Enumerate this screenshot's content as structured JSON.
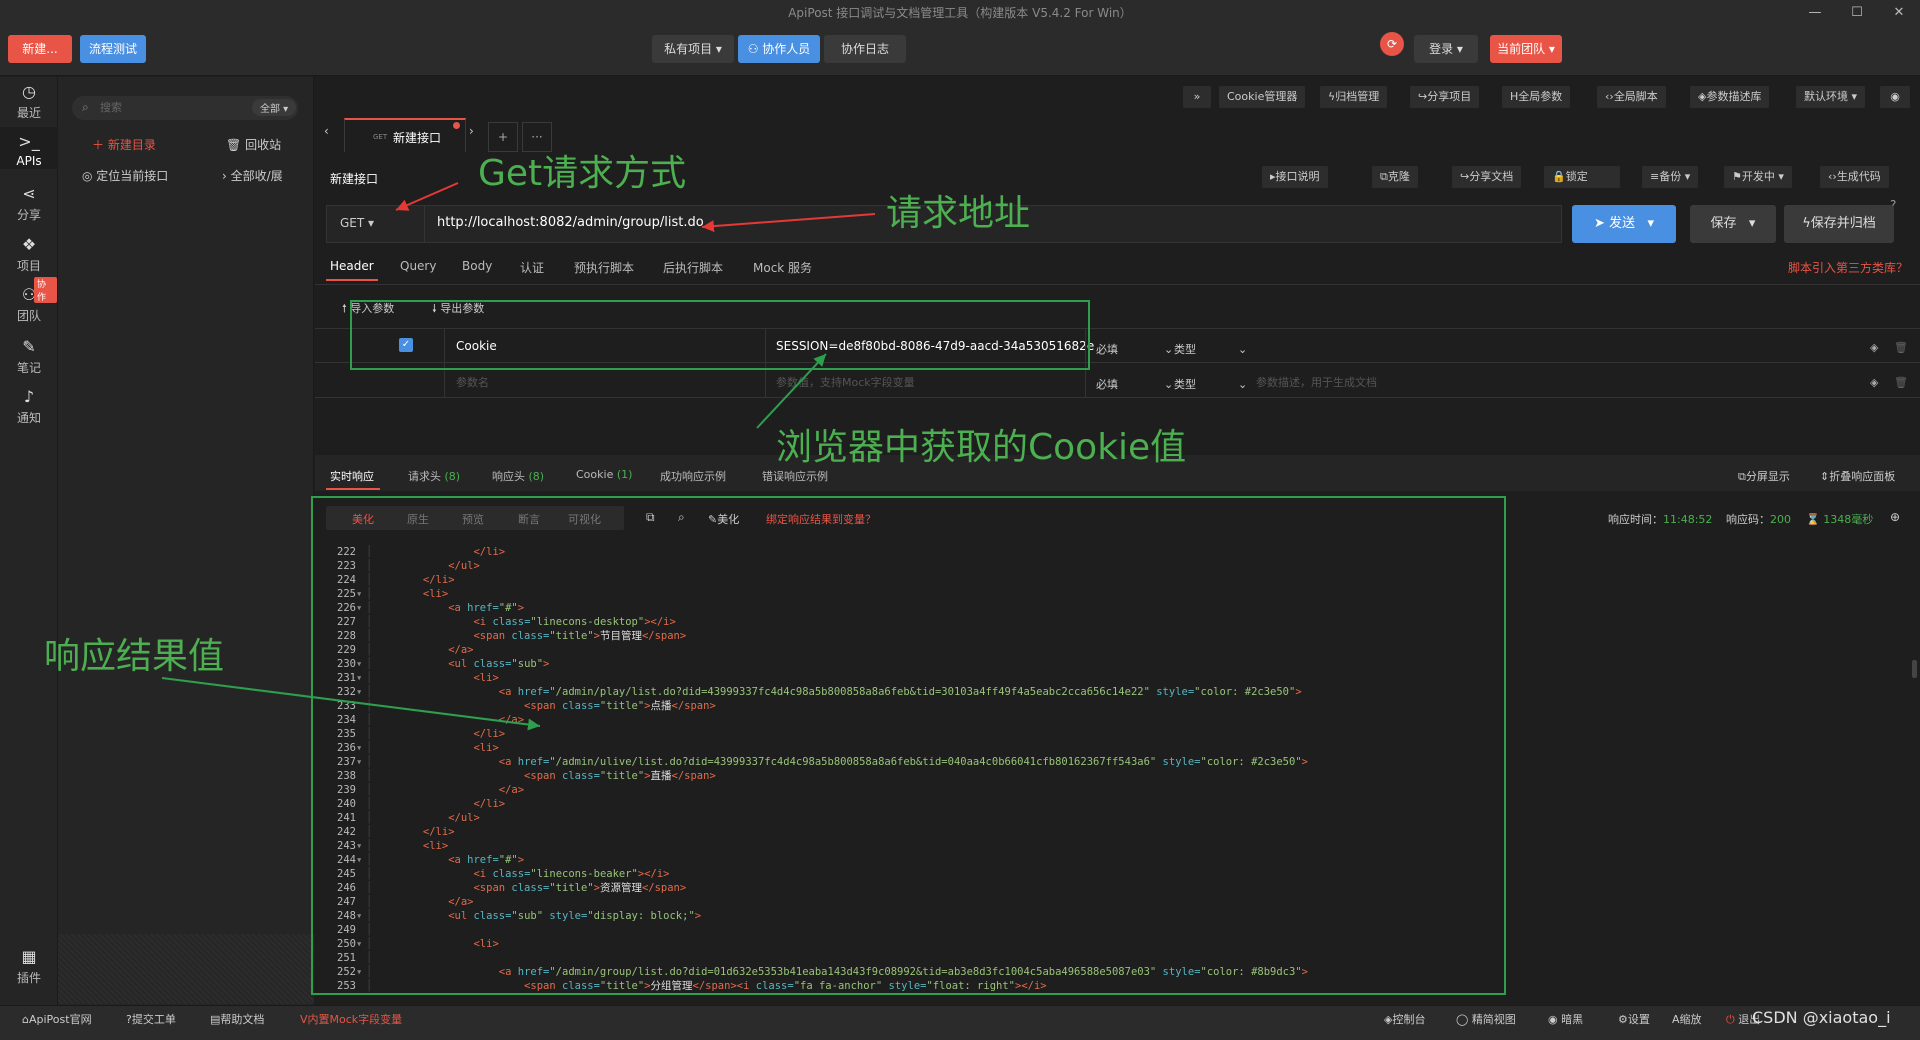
{
  "window": {
    "title": "ApiPost 接口调试与文档管理工具（构建版本 V5.4.2 For Win）"
  },
  "topbar": {
    "new_label": "新建...",
    "flow_label": "流程测试",
    "private_label": "私有项目",
    "collab_label": "协作人员",
    "log_label": "协作日志",
    "login_label": "登录",
    "team_label": "当前团队"
  },
  "leftnav": {
    "items": [
      {
        "label": "最近",
        "icon": "clock-icon"
      },
      {
        "label": "APIs",
        "icon": "terminal-icon"
      },
      {
        "label": "分享",
        "icon": "share-icon"
      },
      {
        "label": "项目",
        "icon": "cubes-icon"
      },
      {
        "label": "团队",
        "icon": "team-icon"
      },
      {
        "label": "笔记",
        "icon": "edit-icon"
      },
      {
        "label": "通知",
        "icon": "bell-icon"
      },
      {
        "label": "插件",
        "icon": "grid-icon"
      }
    ],
    "collab_badge": "协作"
  },
  "sidebar": {
    "search_placeholder": "搜索",
    "filter_label": "全部",
    "new_dir": "新建目录",
    "recycle": "回收站",
    "locate": "定位当前接口",
    "collapse": "全部收/展"
  },
  "toolbar": {
    "items": [
      "Cookie管理器",
      "归档管理",
      "分享项目",
      "全局参数",
      "全局脚本",
      "参数描述库",
      "默认环境"
    ]
  },
  "tab": {
    "method": "GET",
    "label": "新建接口"
  },
  "request": {
    "name": "新建接口",
    "method": "GET",
    "url": "http://localhost:8082/admin/group/list.do",
    "send": "发送",
    "save": "保存",
    "save_archive": "保存并归档",
    "actions": [
      "接口说明",
      "克隆",
      "分享文档",
      "锁定",
      "备份",
      "开发中",
      "生成代码"
    ]
  },
  "req_tabs": [
    "Header",
    "Query",
    "Body",
    "认证",
    "预执行脚本",
    "后执行脚本",
    "Mock 服务"
  ],
  "third_party": "脚本引入第三方类库？",
  "params": {
    "import": "导入参数",
    "export": "导出参数",
    "rows": [
      {
        "key": "Cookie",
        "value": "SESSION=de8f80bd-8086-47d9-aacd-34a53051682e",
        "required": "必填",
        "type": "类型"
      }
    ],
    "key_placeholder": "参数名",
    "value_placeholder": "参数值，支持Mock字段变量",
    "desc_placeholder": "参数描述，用于生成文档",
    "required": "必填",
    "type": "类型"
  },
  "resp_tabs": [
    {
      "label": "实时响应",
      "count": ""
    },
    {
      "label": "请求头",
      "count": "(8)"
    },
    {
      "label": "响应头",
      "count": "(8)"
    },
    {
      "label": "Cookie",
      "count": "(1)"
    },
    {
      "label": "成功响应示例",
      "count": ""
    },
    {
      "label": "错误响应示例",
      "count": ""
    }
  ],
  "resp_right": {
    "split": "分屏显示",
    "fold": "折叠响应面板"
  },
  "view_modes": [
    "美化",
    "原生",
    "预览",
    "断言",
    "可视化"
  ],
  "resp_tools": {
    "beautify": "美化",
    "bind": "绑定响应结果到变量？"
  },
  "resp_meta": {
    "time_label": "响应时间：",
    "time": "11:48:52",
    "code_label": "响应码：",
    "code": "200",
    "ms": "1348毫秒"
  },
  "annotations": {
    "get": "Get请求方式",
    "url": "请求地址",
    "cookie": "浏览器中获取的Cookie值",
    "result": "响应结果值"
  },
  "code_lines": [
    {
      "n": "222",
      "m": "",
      "h": "                </li>"
    },
    {
      "n": "223",
      "m": "",
      "h": "            </ul>"
    },
    {
      "n": "224",
      "m": "",
      "h": "        </li>"
    },
    {
      "n": "225",
      "m": "▾",
      "h": "        <li>"
    },
    {
      "n": "226",
      "m": "▾",
      "h": "            <a href=\"#\">"
    },
    {
      "n": "227",
      "m": "",
      "h": "                <i class=\"linecons-desktop\"></i>"
    },
    {
      "n": "228",
      "m": "",
      "h": "                <span class=\"title\">节目管理</span>"
    },
    {
      "n": "229",
      "m": "",
      "h": "            </a>"
    },
    {
      "n": "230",
      "m": "▾",
      "h": "            <ul class=\"sub\">"
    },
    {
      "n": "231",
      "m": "▾",
      "h": "                <li>"
    },
    {
      "n": "232",
      "m": "▾",
      "e": true,
      "h": "                    <a href=\"/admin/play/list.do?did=43999337fc4d4c98a5b800858a8a6feb&tid=30103a4ff49f4a5eabc2cca656c14e22\" style=\"color: #2c3e50\">"
    },
    {
      "n": "233",
      "m": "",
      "h": "                        <span class=\"title\">点播</span>"
    },
    {
      "n": "234",
      "m": "",
      "h": "                    </a>"
    },
    {
      "n": "235",
      "m": "",
      "h": "                </li>"
    },
    {
      "n": "236",
      "m": "▾",
      "h": "                <li>"
    },
    {
      "n": "237",
      "m": "▾",
      "e": true,
      "h": "                    <a href=\"/admin/ulive/list.do?did=43999337fc4d4c98a5b800858a8a6feb&tid=040aa4c0b66041cfb80162367ff543a6\" style=\"color: #2c3e50\">"
    },
    {
      "n": "238",
      "m": "",
      "h": "                        <span class=\"title\">直播</span>"
    },
    {
      "n": "239",
      "m": "",
      "h": "                    </a>"
    },
    {
      "n": "240",
      "m": "",
      "h": "                </li>"
    },
    {
      "n": "241",
      "m": "",
      "h": "            </ul>"
    },
    {
      "n": "242",
      "m": "",
      "h": "        </li>"
    },
    {
      "n": "243",
      "m": "▾",
      "h": "        <li>"
    },
    {
      "n": "244",
      "m": "▾",
      "h": "            <a href=\"#\">"
    },
    {
      "n": "245",
      "m": "",
      "h": "                <i class=\"linecons-beaker\"></i>"
    },
    {
      "n": "246",
      "m": "",
      "h": "                <span class=\"title\">资源管理</span>"
    },
    {
      "n": "247",
      "m": "",
      "h": "            </a>"
    },
    {
      "n": "248",
      "m": "▾",
      "h": "            <ul class=\"sub\" style=\"display: block;\">"
    },
    {
      "n": "249",
      "m": "",
      "h": ""
    },
    {
      "n": "250",
      "m": "▾",
      "h": "                <li>"
    },
    {
      "n": "251",
      "m": "",
      "h": ""
    },
    {
      "n": "252",
      "m": "▾",
      "e": true,
      "h": "                    <a href=\"/admin/group/list.do?did=01d632e5353b41eaba143d43f9c08992&tid=ab3e8d3fc1004c5aba496588e5087e03\" style=\"color: #8b9dc3\">"
    },
    {
      "n": "253",
      "m": "",
      "h": "                        <span class=\"title\">分组管理</span><i class=\"fa fa-anchor\" style=\"float: right\"></i>"
    }
  ],
  "statusbar": {
    "left": [
      "ApiPost官网",
      "提交工单",
      "帮助文档",
      "内置Mock字段变量"
    ],
    "right": [
      "控制台",
      "精简视图",
      "暗黑",
      "设置",
      "缩放",
      "退出"
    ],
    "watermark": "CSDN @xiaotao_i"
  },
  "colors": {
    "accent_red": "#e85445",
    "accent_blue": "#4a90e2",
    "annotation_green": "#2e9e4f"
  }
}
